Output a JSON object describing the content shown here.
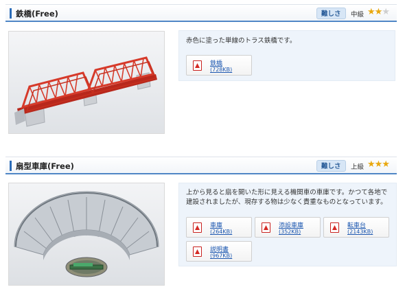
{
  "items": [
    {
      "title": "鉄橋(Free)",
      "difficulty_label": "難しさ",
      "level": "中級",
      "stars_filled": 2,
      "stars_total": 3,
      "star_glyph": "★",
      "description": "赤色に塗った単線のトラス鉄橋です。",
      "downloads": [
        {
          "name": "鉄橋",
          "size": "(728KB)"
        }
      ]
    },
    {
      "title": "扇型車庫(Free)",
      "difficulty_label": "難しさ",
      "level": "上級",
      "stars_filled": 3,
      "stars_total": 3,
      "star_glyph": "★",
      "description_lines": [
        "上から見ると扇を開いた形に見える機関車の車庫です。かつて各地で",
        "建設されましたが、現存する物は少なく貴重なものとなっています。"
      ],
      "downloads": [
        {
          "name": "車庫",
          "size": "(264KB)"
        },
        {
          "name": "添設車庫",
          "size": "(352KB)"
        },
        {
          "name": "転車台",
          "size": "(2143KB)"
        },
        {
          "name": "説明書",
          "size": "(967KB)"
        }
      ]
    }
  ],
  "colors": {
    "accent": "#2b6cb8",
    "star": "#e9a80f",
    "link": "#1a56b0",
    "info_bg": "#eef4fb",
    "bridge_red": "#d63a2a"
  },
  "icons": [
    "pdf-icon",
    "star-icon"
  ]
}
